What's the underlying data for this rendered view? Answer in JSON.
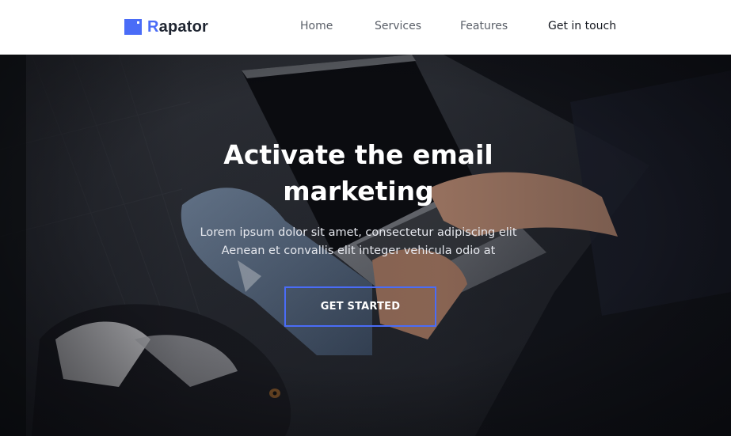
{
  "brand": {
    "first_letter": "R",
    "rest": "apator",
    "accent_color": "#4a6cf7",
    "logo_icon": "square-logo-icon"
  },
  "nav": {
    "items": [
      {
        "label": "Home"
      },
      {
        "label": "Services"
      },
      {
        "label": "Features"
      },
      {
        "label": "Get in touch"
      }
    ]
  },
  "hero": {
    "title": "Activate the email marketing",
    "subtitle_line1": "Lorem ipsum dolor sit amet, consectetur adipiscing elit",
    "subtitle_line2": "Aenean et convallis elit integer vehicula odio at",
    "cta_label": "GET STARTED",
    "background_image": "person-with-laptop-and-dog-photo"
  }
}
